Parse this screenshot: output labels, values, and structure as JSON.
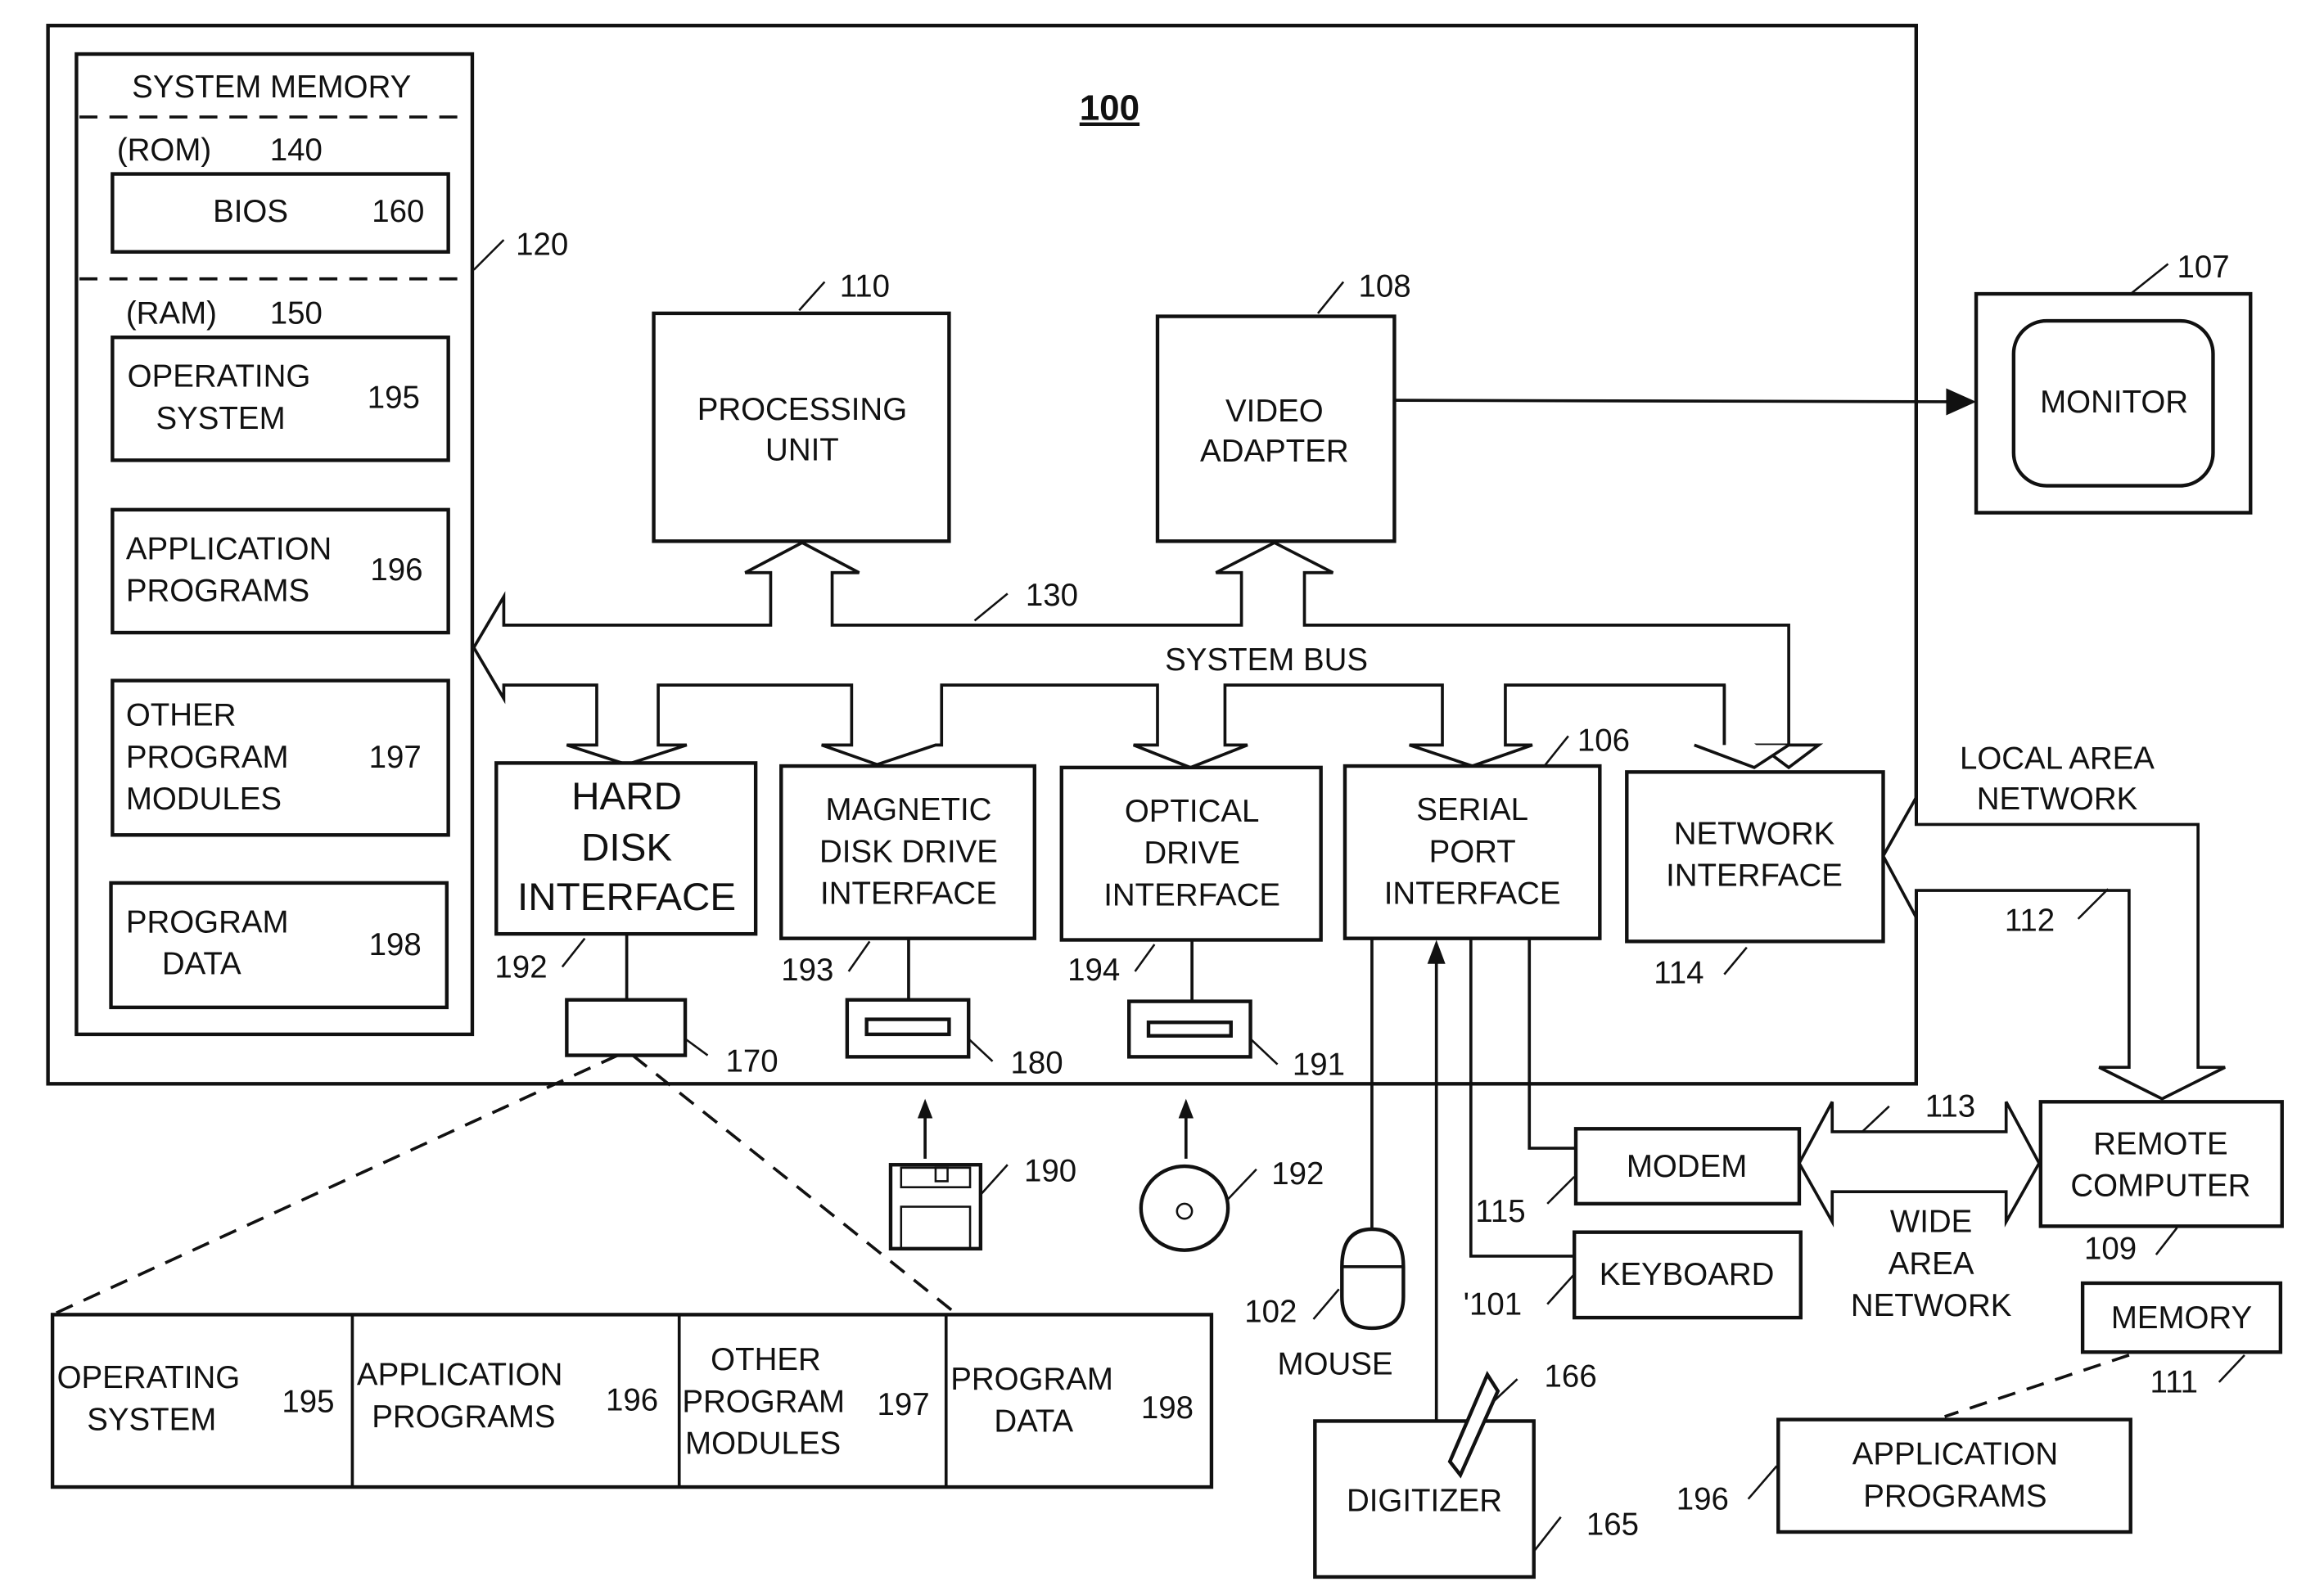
{
  "figure": {
    "title": "100",
    "system_memory": {
      "label": "SYSTEM MEMORY",
      "ref": "120",
      "rom": {
        "label": "(ROM)",
        "ref": "140"
      },
      "bios": {
        "label": "BIOS",
        "ref": "160"
      },
      "ram": {
        "label": "(RAM)",
        "ref": "150"
      },
      "items": [
        {
          "lines": [
            "OPERATING",
            "SYSTEM"
          ],
          "ref": "195"
        },
        {
          "lines": [
            "APPLICATION",
            "PROGRAMS"
          ],
          "ref": "196"
        },
        {
          "lines": [
            "OTHER",
            "PROGRAM",
            "MODULES"
          ],
          "ref": "197"
        },
        {
          "lines": [
            "PROGRAM",
            "DATA"
          ],
          "ref": "198"
        }
      ]
    },
    "processing_unit": {
      "lines": [
        "PROCESSING",
        "UNIT"
      ],
      "ref": "110"
    },
    "video_adapter": {
      "lines": [
        "VIDEO",
        "ADAPTER"
      ],
      "ref": "108"
    },
    "monitor": {
      "label": "MONITOR",
      "ref": "107"
    },
    "system_bus": {
      "label": "SYSTEM BUS",
      "ref": "130"
    },
    "interfaces": [
      {
        "lines": [
          "HARD",
          "DISK",
          "INTERFACE"
        ],
        "ref": "192"
      },
      {
        "lines": [
          "MAGNETIC",
          "DISK DRIVE",
          "INTERFACE"
        ],
        "ref": "193"
      },
      {
        "lines": [
          "OPTICAL",
          "DRIVE",
          "INTERFACE"
        ],
        "ref": "194"
      },
      {
        "lines": [
          "SERIAL",
          "PORT",
          "INTERFACE"
        ],
        "ref": "106"
      },
      {
        "lines": [
          "NETWORK",
          "INTERFACE"
        ],
        "ref": "114"
      }
    ],
    "drives": {
      "hard_disk": {
        "ref": "170"
      },
      "magnetic_disk_drive": {
        "ref": "180"
      },
      "optical_drive": {
        "ref": "191"
      },
      "floppy_disk": {
        "ref": "190"
      },
      "optical_disk": {
        "ref": "192"
      }
    },
    "hard_disk_contents": [
      {
        "lines": [
          "OPERATING",
          "SYSTEM"
        ],
        "ref": "195"
      },
      {
        "lines": [
          "APPLICATION",
          "PROGRAMS"
        ],
        "ref": "196"
      },
      {
        "lines": [
          "OTHER",
          "PROGRAM",
          "MODULES"
        ],
        "ref": "197"
      },
      {
        "lines": [
          "PROGRAM",
          "DATA"
        ],
        "ref": "198"
      }
    ],
    "mouse": {
      "label": "MOUSE",
      "ref": "102"
    },
    "modem": {
      "label": "MODEM",
      "ref": "115"
    },
    "keyboard": {
      "label": "KEYBOARD",
      "ref": "'101"
    },
    "digitizer": {
      "label": "DIGITIZER",
      "ref": "165",
      "pen_ref": "166"
    },
    "lan": {
      "lines": [
        "LOCAL AREA",
        "NETWORK"
      ],
      "ref": "112"
    },
    "wan": {
      "lines": [
        "WIDE",
        "AREA",
        "NETWORK"
      ],
      "ref": "113"
    },
    "remote_computer": {
      "lines": [
        "REMOTE",
        "COMPUTER"
      ],
      "ref": "109"
    },
    "remote_memory": {
      "label": "MEMORY",
      "ref": "111"
    },
    "remote_apps": {
      "lines": [
        "APPLICATION",
        "PROGRAMS"
      ],
      "ref": "196"
    }
  }
}
